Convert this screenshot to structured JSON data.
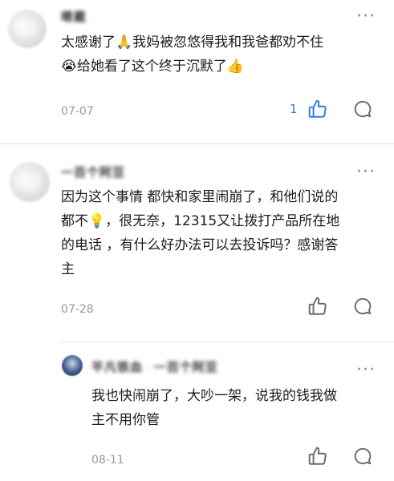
{
  "comments": [
    {
      "username": "嗯戴",
      "text_line1": "太感谢了🙏我妈被忽悠得我和我爸都劝不住",
      "text_line2": "😭给她看了这个终于沉默了👍",
      "date": "07-07",
      "like_count": "1",
      "liked": true
    },
    {
      "username": "一百个阿豆",
      "text_line1": "因为这个事情 都快和家里闹崩了，和他们说的",
      "text_line2": "都不💡，很无奈，12315又让拨打产品所在地",
      "text_line3": "的电话 ，有什么好办法可以去投诉吗？感谢答",
      "text_line4": "主",
      "date": "07-28"
    },
    {
      "username": "平凡铁血",
      "reply_to": "一百个阿豆",
      "text_line1": "我也快闹崩了，大吵一架，说我的钱我做",
      "text_line2": "主不用你管",
      "date": "08-11"
    }
  ],
  "icons": {
    "like": "thumbs-up-icon",
    "comment": "speech-bubble-icon",
    "more": "more-dots-icon"
  },
  "colors": {
    "liked": "#2f7de1",
    "icon": "#6b6b6b",
    "date": "#9a9a9a"
  }
}
